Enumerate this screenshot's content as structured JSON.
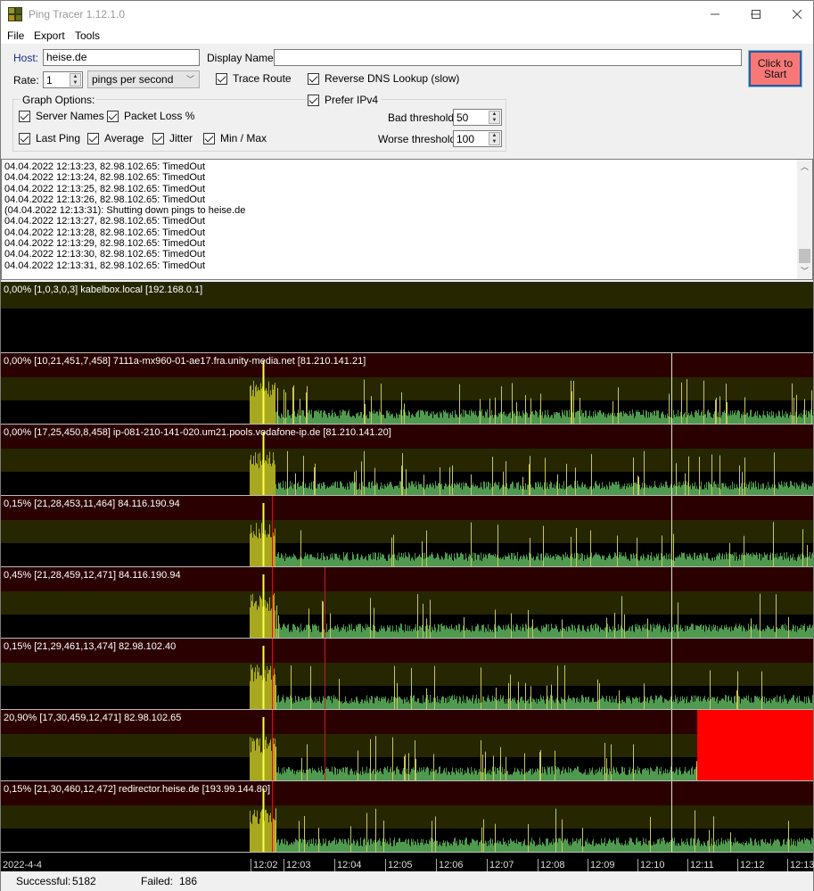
{
  "window": {
    "title": "Ping Tracer 1.12.1.0",
    "icon": "ping-tracer-app-icon",
    "controls": [
      "minimize",
      "maximize",
      "close"
    ]
  },
  "menu": [
    "File",
    "Export",
    "Tools"
  ],
  "form": {
    "host_label": "Host:",
    "host_value": "heise.de",
    "display_name_label": "Display Name:",
    "display_name_value": "",
    "rate_label": "Rate:",
    "rate_value": "1",
    "rate_unit": "pings per second",
    "trace_route": {
      "label": "Trace Route",
      "checked": true
    },
    "reverse_dns": {
      "label": "Reverse DNS Lookup (slow)",
      "checked": true
    },
    "prefer_ipv4": {
      "label": "Prefer IPv4",
      "checked": true
    },
    "start_button": "Click to\nStart",
    "start_button_color": "#f87878"
  },
  "graph_options": {
    "title": "Graph Options:",
    "server_names": {
      "label": "Server Names",
      "checked": true
    },
    "packet_loss": {
      "label": "Packet Loss %",
      "checked": true
    },
    "last_ping": {
      "label": "Last Ping",
      "checked": true
    },
    "average": {
      "label": "Average",
      "checked": true
    },
    "jitter": {
      "label": "Jitter",
      "checked": true
    },
    "min_max": {
      "label": "Min / Max",
      "checked": true
    },
    "bad_threshold_label": "Bad threshold:",
    "bad_threshold_value": "50",
    "worse_threshold_label": "Worse threshold:",
    "worse_threshold_value": "100"
  },
  "log": [
    "04.04.2022 12:13:23, 82.98.102.65: TimedOut",
    "04.04.2022 12:13:24, 82.98.102.65: TimedOut",
    "04.04.2022 12:13:25, 82.98.102.65: TimedOut",
    "04.04.2022 12:13:26, 82.98.102.65: TimedOut",
    "(04.04.2022 12:13:31): Shutting down pings to heise.de",
    "04.04.2022 12:13:27, 82.98.102.65: TimedOut",
    "04.04.2022 12:13:28, 82.98.102.65: TimedOut",
    "04.04.2022 12:13:29, 82.98.102.65: TimedOut",
    "04.04.2022 12:13:30, 82.98.102.65: TimedOut",
    "04.04.2022 12:13:31, 82.98.102.65: TimedOut"
  ],
  "colors": {
    "good": "#4f9a4f",
    "bad_band": "#262600",
    "worse_band": "#2a0000",
    "spike": "#c8c85a",
    "highlight": "#ffff40",
    "loss": "#ff0000",
    "startup": "#a8a820"
  },
  "hops": [
    {
      "label": "0,00% [1,0,3,0,3] kabelbox.local [192.168.0.1]",
      "loss_pct": 0.0,
      "kind": "local"
    },
    {
      "label": "0,00% [10,21,451,7,458] 7111a-mx960-01-ae17.fra.unity-media.net [81.210.141.21]",
      "loss_pct": 0.0,
      "kind": "normal"
    },
    {
      "label": "0,00%  [17,25,450,8,458] ip-081-210-141-020.um21.pools.vodafone-ip.de  [81.210.141.20]",
      "loss_pct": 0.0,
      "kind": "normal"
    },
    {
      "label": "0,15% [21,28,453,11,464] 84.116.190.94",
      "loss_pct": 0.15,
      "kind": "normal"
    },
    {
      "label": "0,45% [21,28,459,12,471] 84.116.190.94",
      "loss_pct": 0.45,
      "kind": "normal"
    },
    {
      "label": "0,15% [21,29,461,13,474] 82.98.102.40",
      "loss_pct": 0.15,
      "kind": "normal"
    },
    {
      "label": "20,90% [17,30,459,12,471] 82.98.102.65",
      "loss_pct": 20.9,
      "kind": "timeout-tail"
    },
    {
      "label": "0,15% [21,30,460,12,472] redirector.heise.de [193.99.144.80]",
      "loss_pct": 0.15,
      "kind": "normal"
    }
  ],
  "timeline": {
    "date": "2022-4-4",
    "ticks": [
      "12:02",
      "12:03",
      "12:04",
      "12:05",
      "12:06",
      "12:07",
      "12:08",
      "12:09",
      "12:10",
      "12:11",
      "12:12",
      "12:13"
    ]
  },
  "status": {
    "successful_label": "Successful:",
    "successful_value": "5182",
    "failed_label": "Failed:",
    "failed_value": "186"
  }
}
